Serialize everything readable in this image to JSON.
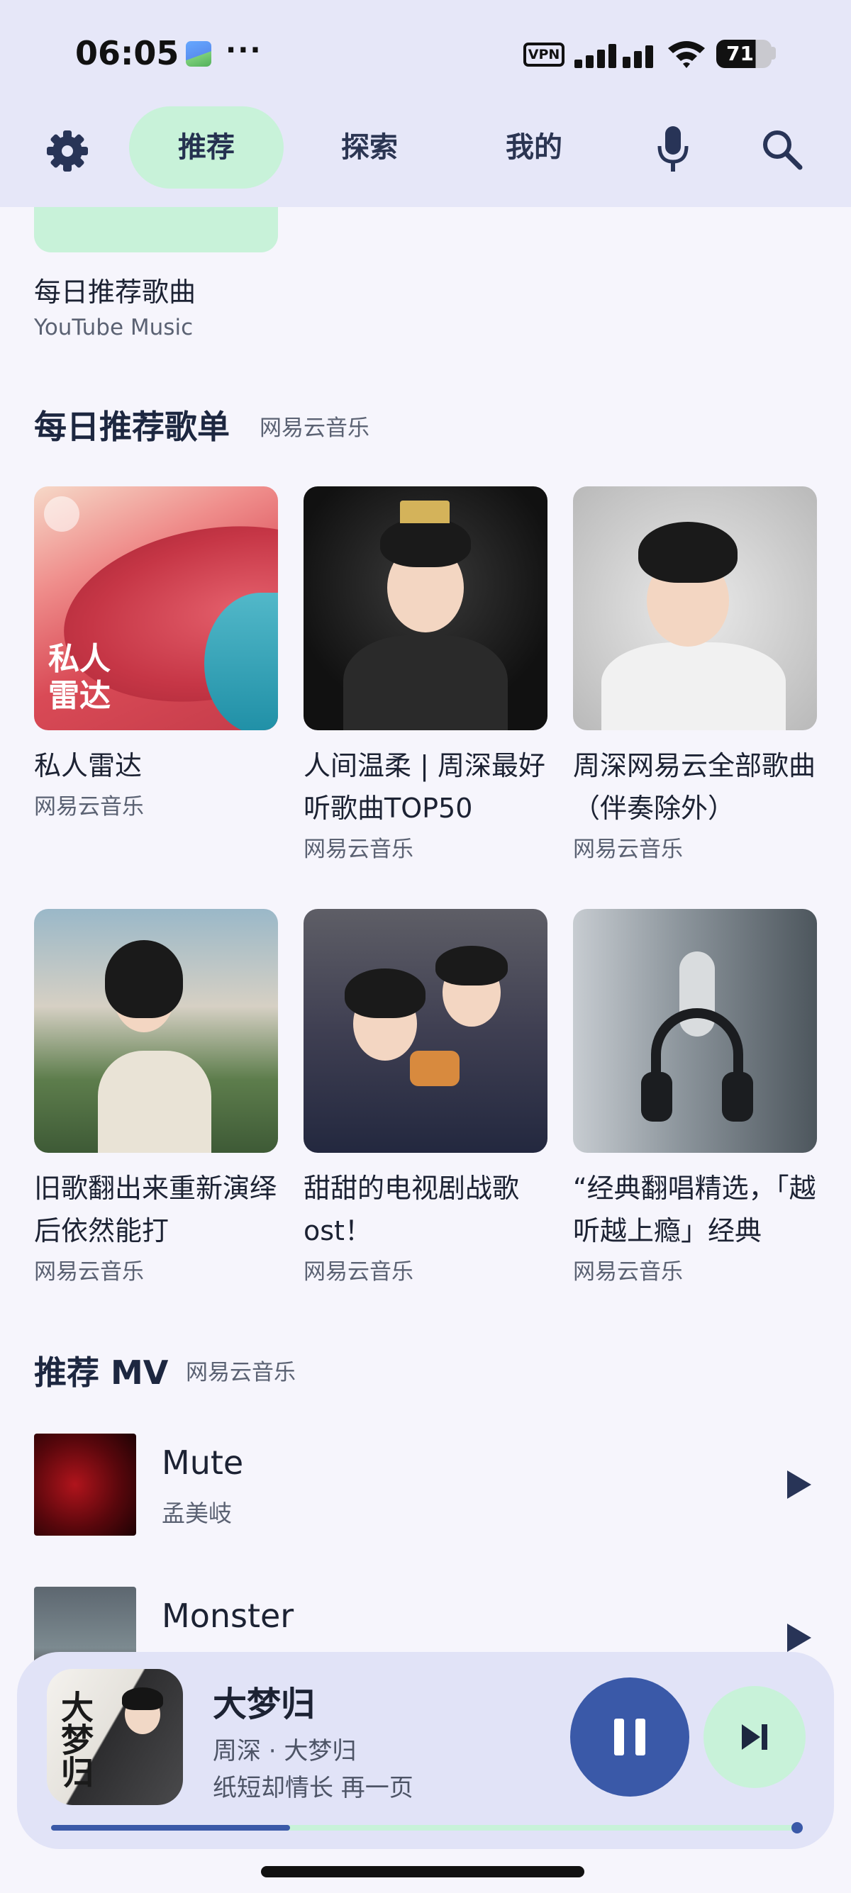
{
  "status_bar": {
    "time": "06:05",
    "more": "···",
    "vpn": "VPN",
    "battery": "71",
    "icons": [
      "gallery-icon",
      "vpn-icon",
      "signal-icon",
      "wifi-icon",
      "battery-icon"
    ]
  },
  "nav": {
    "tabs": [
      {
        "label": "推荐",
        "active": true
      },
      {
        "label": "探索",
        "active": false
      },
      {
        "label": "我的",
        "active": false
      }
    ],
    "icons": [
      "settings-icon",
      "mic-icon",
      "search-icon"
    ],
    "accent": "#c8f2d9"
  },
  "daily_songs": {
    "title": "每日推荐歌曲",
    "source": "YouTube Music"
  },
  "playlists_section": {
    "title": "每日推荐歌单",
    "source": "网易云音乐",
    "cover_text": "私人\n雷达",
    "items": [
      {
        "title": "私人雷达",
        "sub": "网易云音乐"
      },
      {
        "title": "人间温柔 | 周深最好听歌曲TOP50",
        "sub": "网易云音乐"
      },
      {
        "title": "周深网易云全部歌曲（伴奏除外）",
        "sub": "网易云音乐"
      },
      {
        "title": "旧歌翻出来重新演绎后依然能打",
        "sub": "网易云音乐"
      },
      {
        "title": "甜甜的电视剧战歌ost！",
        "sub": "网易云音乐"
      },
      {
        "title": "“经典翻唱精选，「越听越上瘾」经典",
        "sub": "网易云音乐"
      }
    ]
  },
  "mv_section": {
    "title": "推荐 MV",
    "source": "网易云音乐",
    "items": [
      {
        "title": "Mute",
        "artist": "孟美岐"
      },
      {
        "title": "Monster",
        "artist": ""
      }
    ]
  },
  "now_playing": {
    "cover_text": "大梦归",
    "title": "大梦归",
    "artist_line": "周深 · 大梦归",
    "lyric": "纸短却情长 再一页",
    "progress": 0.32,
    "primary_color": "#3a59a8"
  }
}
